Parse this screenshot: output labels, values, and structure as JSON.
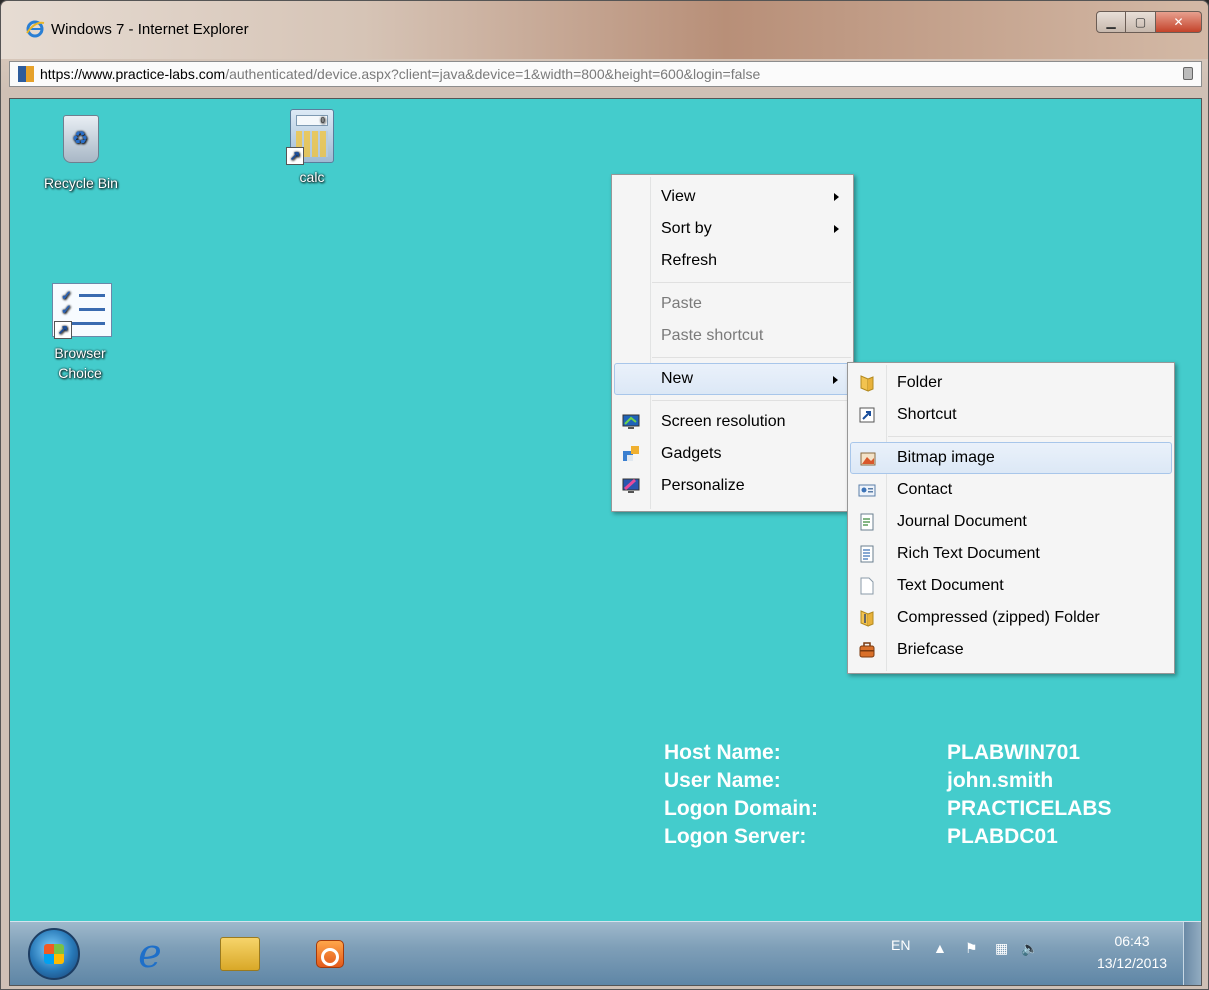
{
  "window": {
    "title": "Windows 7 - Internet Explorer",
    "controls": [
      "minimize",
      "maximize",
      "close"
    ]
  },
  "address": {
    "protocol": "https://",
    "host": "www.practice-labs.com",
    "path": "/authenticated/device.aspx?client=java&device=1&width=800&height=600&login=false"
  },
  "desktop": {
    "background_color": "#44cccc",
    "icons": [
      {
        "label": "Recycle Bin",
        "icon": "recycle-bin-icon"
      },
      {
        "label": "calc",
        "icon": "calculator-icon"
      },
      {
        "label": "Browser Choice",
        "icon": "browser-choice-icon"
      }
    ]
  },
  "context_menu": {
    "items": [
      {
        "label": "View",
        "submenu": true
      },
      {
        "label": "Sort by",
        "submenu": true
      },
      {
        "label": "Refresh"
      },
      {
        "label": "Paste",
        "disabled": true
      },
      {
        "label": "Paste shortcut",
        "disabled": true
      },
      {
        "label": "New",
        "submenu": true,
        "highlighted": true
      },
      {
        "label": "Screen resolution",
        "icon": "screen-resolution-icon"
      },
      {
        "label": "Gadgets",
        "icon": "gadgets-icon"
      },
      {
        "label": "Personalize",
        "icon": "personalize-icon"
      }
    ]
  },
  "new_submenu": {
    "items": [
      {
        "label": "Folder",
        "icon": "folder-icon"
      },
      {
        "label": "Shortcut",
        "icon": "shortcut-icon"
      },
      {
        "label": "Bitmap image",
        "icon": "bitmap-icon",
        "highlighted": true
      },
      {
        "label": "Contact",
        "icon": "contact-icon"
      },
      {
        "label": "Journal Document",
        "icon": "journal-icon"
      },
      {
        "label": "Rich Text Document",
        "icon": "rich-text-icon"
      },
      {
        "label": "Text Document",
        "icon": "text-document-icon"
      },
      {
        "label": "Compressed (zipped) Folder",
        "icon": "zip-folder-icon"
      },
      {
        "label": "Briefcase",
        "icon": "briefcase-icon"
      }
    ]
  },
  "info": {
    "host_label": "Host Name:",
    "host_value": "PLABWIN701",
    "user_label": "User Name:",
    "user_value": "john.smith",
    "domain_label": "Logon Domain:",
    "domain_value": "PRACTICELABS",
    "server_label": "Logon Server:",
    "server_value": "PLABDC01"
  },
  "taskbar": {
    "apps": [
      "start-orb",
      "internet-explorer-icon",
      "windows-explorer-icon",
      "media-player-icon"
    ],
    "language": "EN",
    "time": "06:43",
    "date": "13/12/2013"
  }
}
